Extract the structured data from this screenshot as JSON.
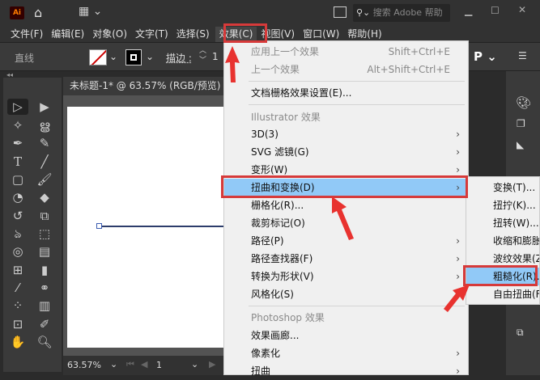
{
  "titlebar": {
    "app_icon": "Ai",
    "search_placeholder": "搜索 Adobe 帮助"
  },
  "menubar": [
    "文件(F)",
    "编辑(E)",
    "对象(O)",
    "文字(T)",
    "选择(S)",
    "效果(C)",
    "视图(V)",
    "窗口(W)",
    "帮助(H)"
  ],
  "control": {
    "object_label": "直线",
    "stroke_label": "描边 :",
    "stroke_value": "1"
  },
  "document": {
    "tab_title": "未标题-1* @ 63.57% (RGB/预览)",
    "zoom": "63.57%",
    "page": "1"
  },
  "effect_menu": {
    "apply_last": {
      "label": "应用上一个效果",
      "shortcut": "Shift+Ctrl+E"
    },
    "last": {
      "label": "上一个效果",
      "shortcut": "Alt+Shift+Ctrl+E"
    },
    "doc_raster": "文档栅格效果设置(E)...",
    "illustrator_header": "Illustrator 效果",
    "illustrator_items": [
      {
        "label": "3D(3)",
        "submenu": true
      },
      {
        "label": "SVG 滤镜(G)",
        "submenu": true
      },
      {
        "label": "变形(W)",
        "submenu": true
      },
      {
        "label": "扭曲和变换(D)",
        "submenu": true,
        "highlighted": true
      },
      {
        "label": "栅格化(R)...",
        "submenu": false
      },
      {
        "label": "裁剪标记(O)",
        "submenu": false
      },
      {
        "label": "路径(P)",
        "submenu": true
      },
      {
        "label": "路径查找器(F)",
        "submenu": true
      },
      {
        "label": "转换为形状(V)",
        "submenu": true
      },
      {
        "label": "风格化(S)",
        "submenu": true
      }
    ],
    "photoshop_header": "Photoshop 效果",
    "photoshop_items": [
      {
        "label": "效果画廊...",
        "submenu": false
      },
      {
        "label": "像素化",
        "submenu": true
      },
      {
        "label": "扭曲",
        "submenu": true
      }
    ]
  },
  "submenu": [
    "变换(T)...",
    "扭拧(K)...",
    "扭转(W)...",
    "收缩和膨胀(P)...",
    "波纹效果(Z)...",
    "粗糙化(R)...",
    "自由扭曲(F)..."
  ],
  "submenu_highlight_index": 5,
  "colors": {
    "highlight": "#91c9f7",
    "annotation": "#d63a3a"
  }
}
